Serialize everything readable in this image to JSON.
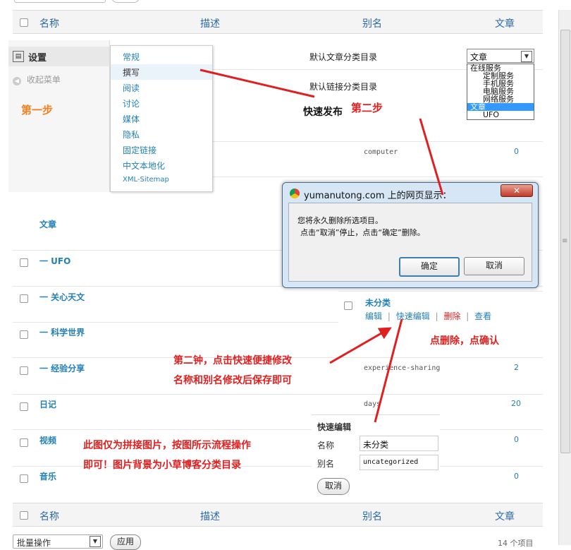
{
  "table": {
    "headers": {
      "name": "名称",
      "desc": "描述",
      "slug": "别名",
      "posts": "文章"
    },
    "rows": [
      {
        "name": "文章",
        "slug": "",
        "count": ""
      },
      {
        "name": "一 UFO",
        "slug": "",
        "count": ""
      },
      {
        "name": "一 关心天文",
        "slug": "",
        "count": ""
      },
      {
        "name": "一 科学世界",
        "slug": "",
        "count": ""
      },
      {
        "name": "一 经验分享",
        "slug": "experience-sharing",
        "count": "2"
      },
      {
        "name": "日记",
        "slug": "days",
        "count": "20"
      },
      {
        "name": "视频",
        "slug": "",
        "count": "0"
      },
      {
        "name": "音乐",
        "slug": "",
        "count": "0"
      }
    ],
    "computer_row": {
      "slug": "computer",
      "count": "0"
    }
  },
  "admin_menu": {
    "settings_label": "设置",
    "collapse_label": "收起菜单",
    "submenu": [
      "常规",
      "撰写",
      "阅读",
      "讨论",
      "媒体",
      "隐私",
      "固定链接",
      "中文本地化",
      "XML-Sitemap"
    ]
  },
  "writing_settings": {
    "default_category_label": "默认文章分类目录",
    "default_link_category_label": "默认链接分类目录",
    "select_value": "文章",
    "options": [
      "在线服务",
      "定制服务",
      "手机服务",
      "电脑服务",
      "网络服务",
      "文章",
      "UFO"
    ]
  },
  "dialog": {
    "title": "yumanutong.com 上的网页显示：",
    "message_line1": "您将永久删除所选项目。",
    "message_line2": "点击“取消”停止，点击“确定”删除。",
    "ok_label": "确定",
    "cancel_label": "取消"
  },
  "uncategorized": {
    "name": "未分类",
    "actions": {
      "edit": "编辑",
      "quick_edit": "快速编辑",
      "delete": "删除",
      "view": "查看"
    },
    "sep": "|"
  },
  "quick_edit": {
    "title": "快速编辑",
    "name_label": "名称",
    "name_value": "未分类",
    "slug_label": "别名",
    "slug_value": "uncategorized",
    "cancel_label": "取消"
  },
  "annotations": {
    "step1": "第一步",
    "step2": "第二步",
    "quick_publish": "快速发布",
    "click_delete": "点删除，点确认",
    "second_way_line1": "第二钟，点击快速便捷修改",
    "second_way_line2": "名称和别名修改后保存即可",
    "note_line1": "此图仅为拼接图片，按图所示流程操作",
    "note_line2": "即可！图片背景为小草博客分类目录"
  },
  "footer": {
    "bulk_label": "批量操作",
    "apply_label": "应用",
    "items_count": "14 个项目"
  },
  "colors": {
    "accent": "#2280b7",
    "annotation_red": "#e02020",
    "annotation_orange": "#f08020"
  }
}
